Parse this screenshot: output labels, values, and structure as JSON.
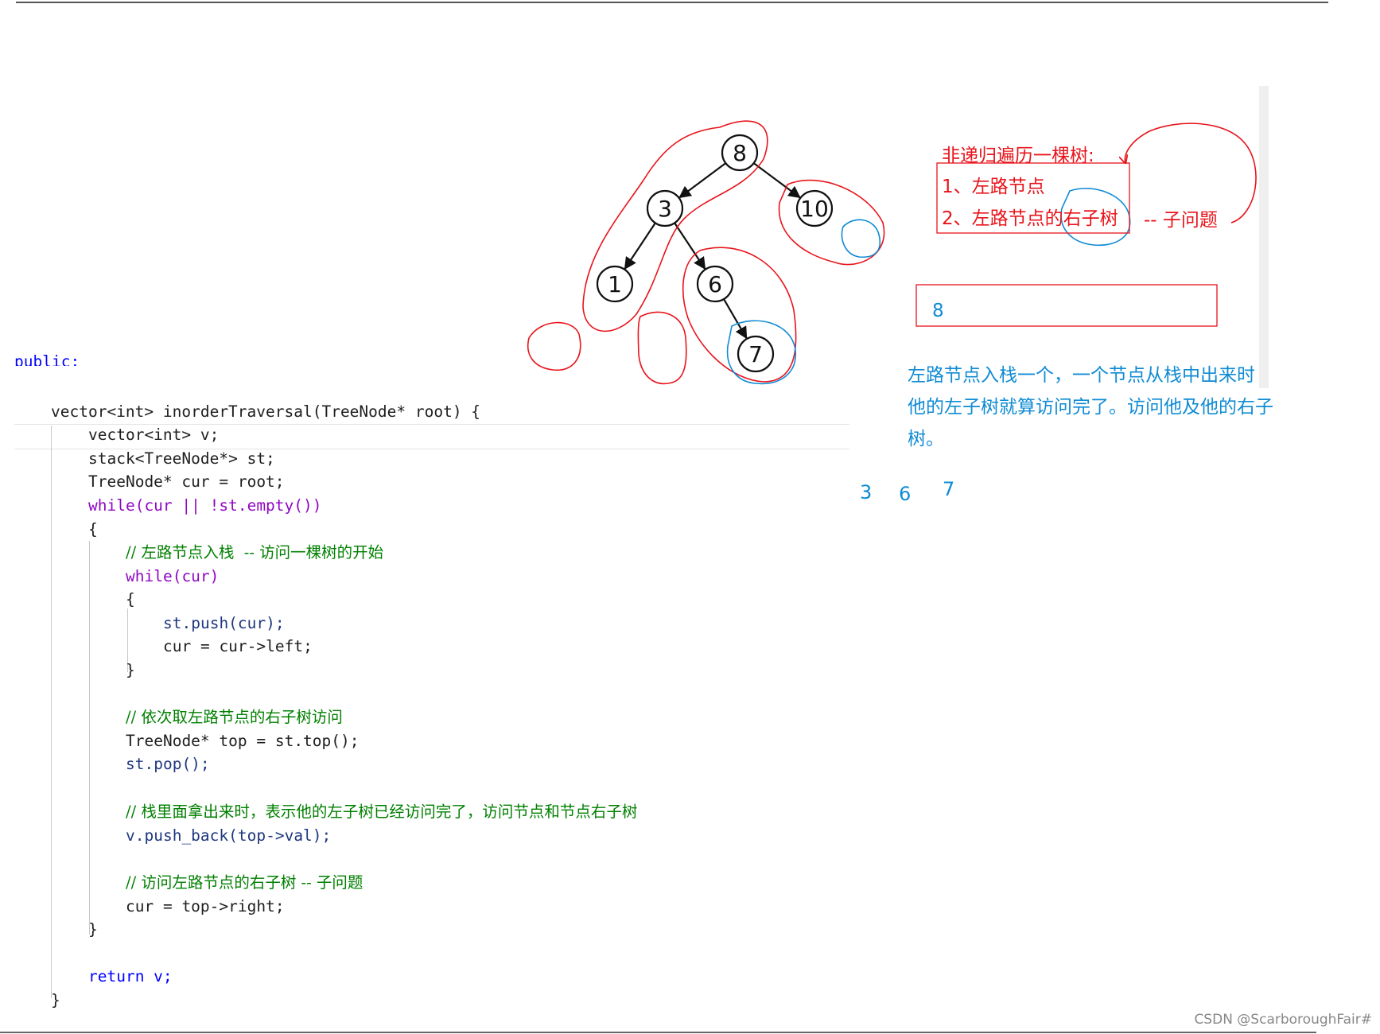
{
  "code": {
    "lines": [
      "public:",
      "vector<int> inorderTraversal(TreeNode* root) {",
      "vector<int> v;",
      "stack<TreeNode*> st;",
      "TreeNode* cur = root;",
      "while(cur || !st.empty())",
      "{",
      "// 左路节点入栈  -- 访问一棵树的开始",
      "while(cur)",
      "{",
      "st.push(cur);",
      "cur = cur->left;",
      "}",
      "// 依次取左路节点的右子树访问",
      "TreeNode* top = st.top();",
      "st.pop();",
      "// 栈里面拿出来时，表示他的左子树已经访问完了，访问节点和节点右子树",
      "v.push_back(top->val);",
      "// 访问左路节点的右子树 -- 子问题",
      "cur = top->right;",
      "}",
      "return v;",
      "}"
    ]
  },
  "tree": {
    "nodes": [
      {
        "id": "8",
        "label": "8"
      },
      {
        "id": "3",
        "label": "3"
      },
      {
        "id": "10",
        "label": "10"
      },
      {
        "id": "1",
        "label": "1"
      },
      {
        "id": "6",
        "label": "6"
      },
      {
        "id": "7",
        "label": "7"
      }
    ],
    "edges": [
      [
        "8",
        "3"
      ],
      [
        "8",
        "10"
      ],
      [
        "3",
        "1"
      ],
      [
        "3",
        "6"
      ],
      [
        "6",
        "7"
      ]
    ]
  },
  "notes": {
    "title": "非递归遍历一棵树:",
    "item1": "1、左路节点",
    "item2": "2、左路节点的右子树",
    "item2_suffix": "-- 子问题",
    "stack_box_value": "8",
    "explain_line1": "左路节点入栈一个，一个节点从栈中出来时",
    "explain_line2": "他的左子树就算访问完了。访问他及他的右子",
    "explain_line3": "树。",
    "output_values": [
      "3",
      "6",
      "7"
    ]
  },
  "watermark": "CSDN @ScarboroughFair#",
  "colors": {
    "annotation_red": "#e8141b",
    "annotation_blue": "#0f8bd4"
  }
}
